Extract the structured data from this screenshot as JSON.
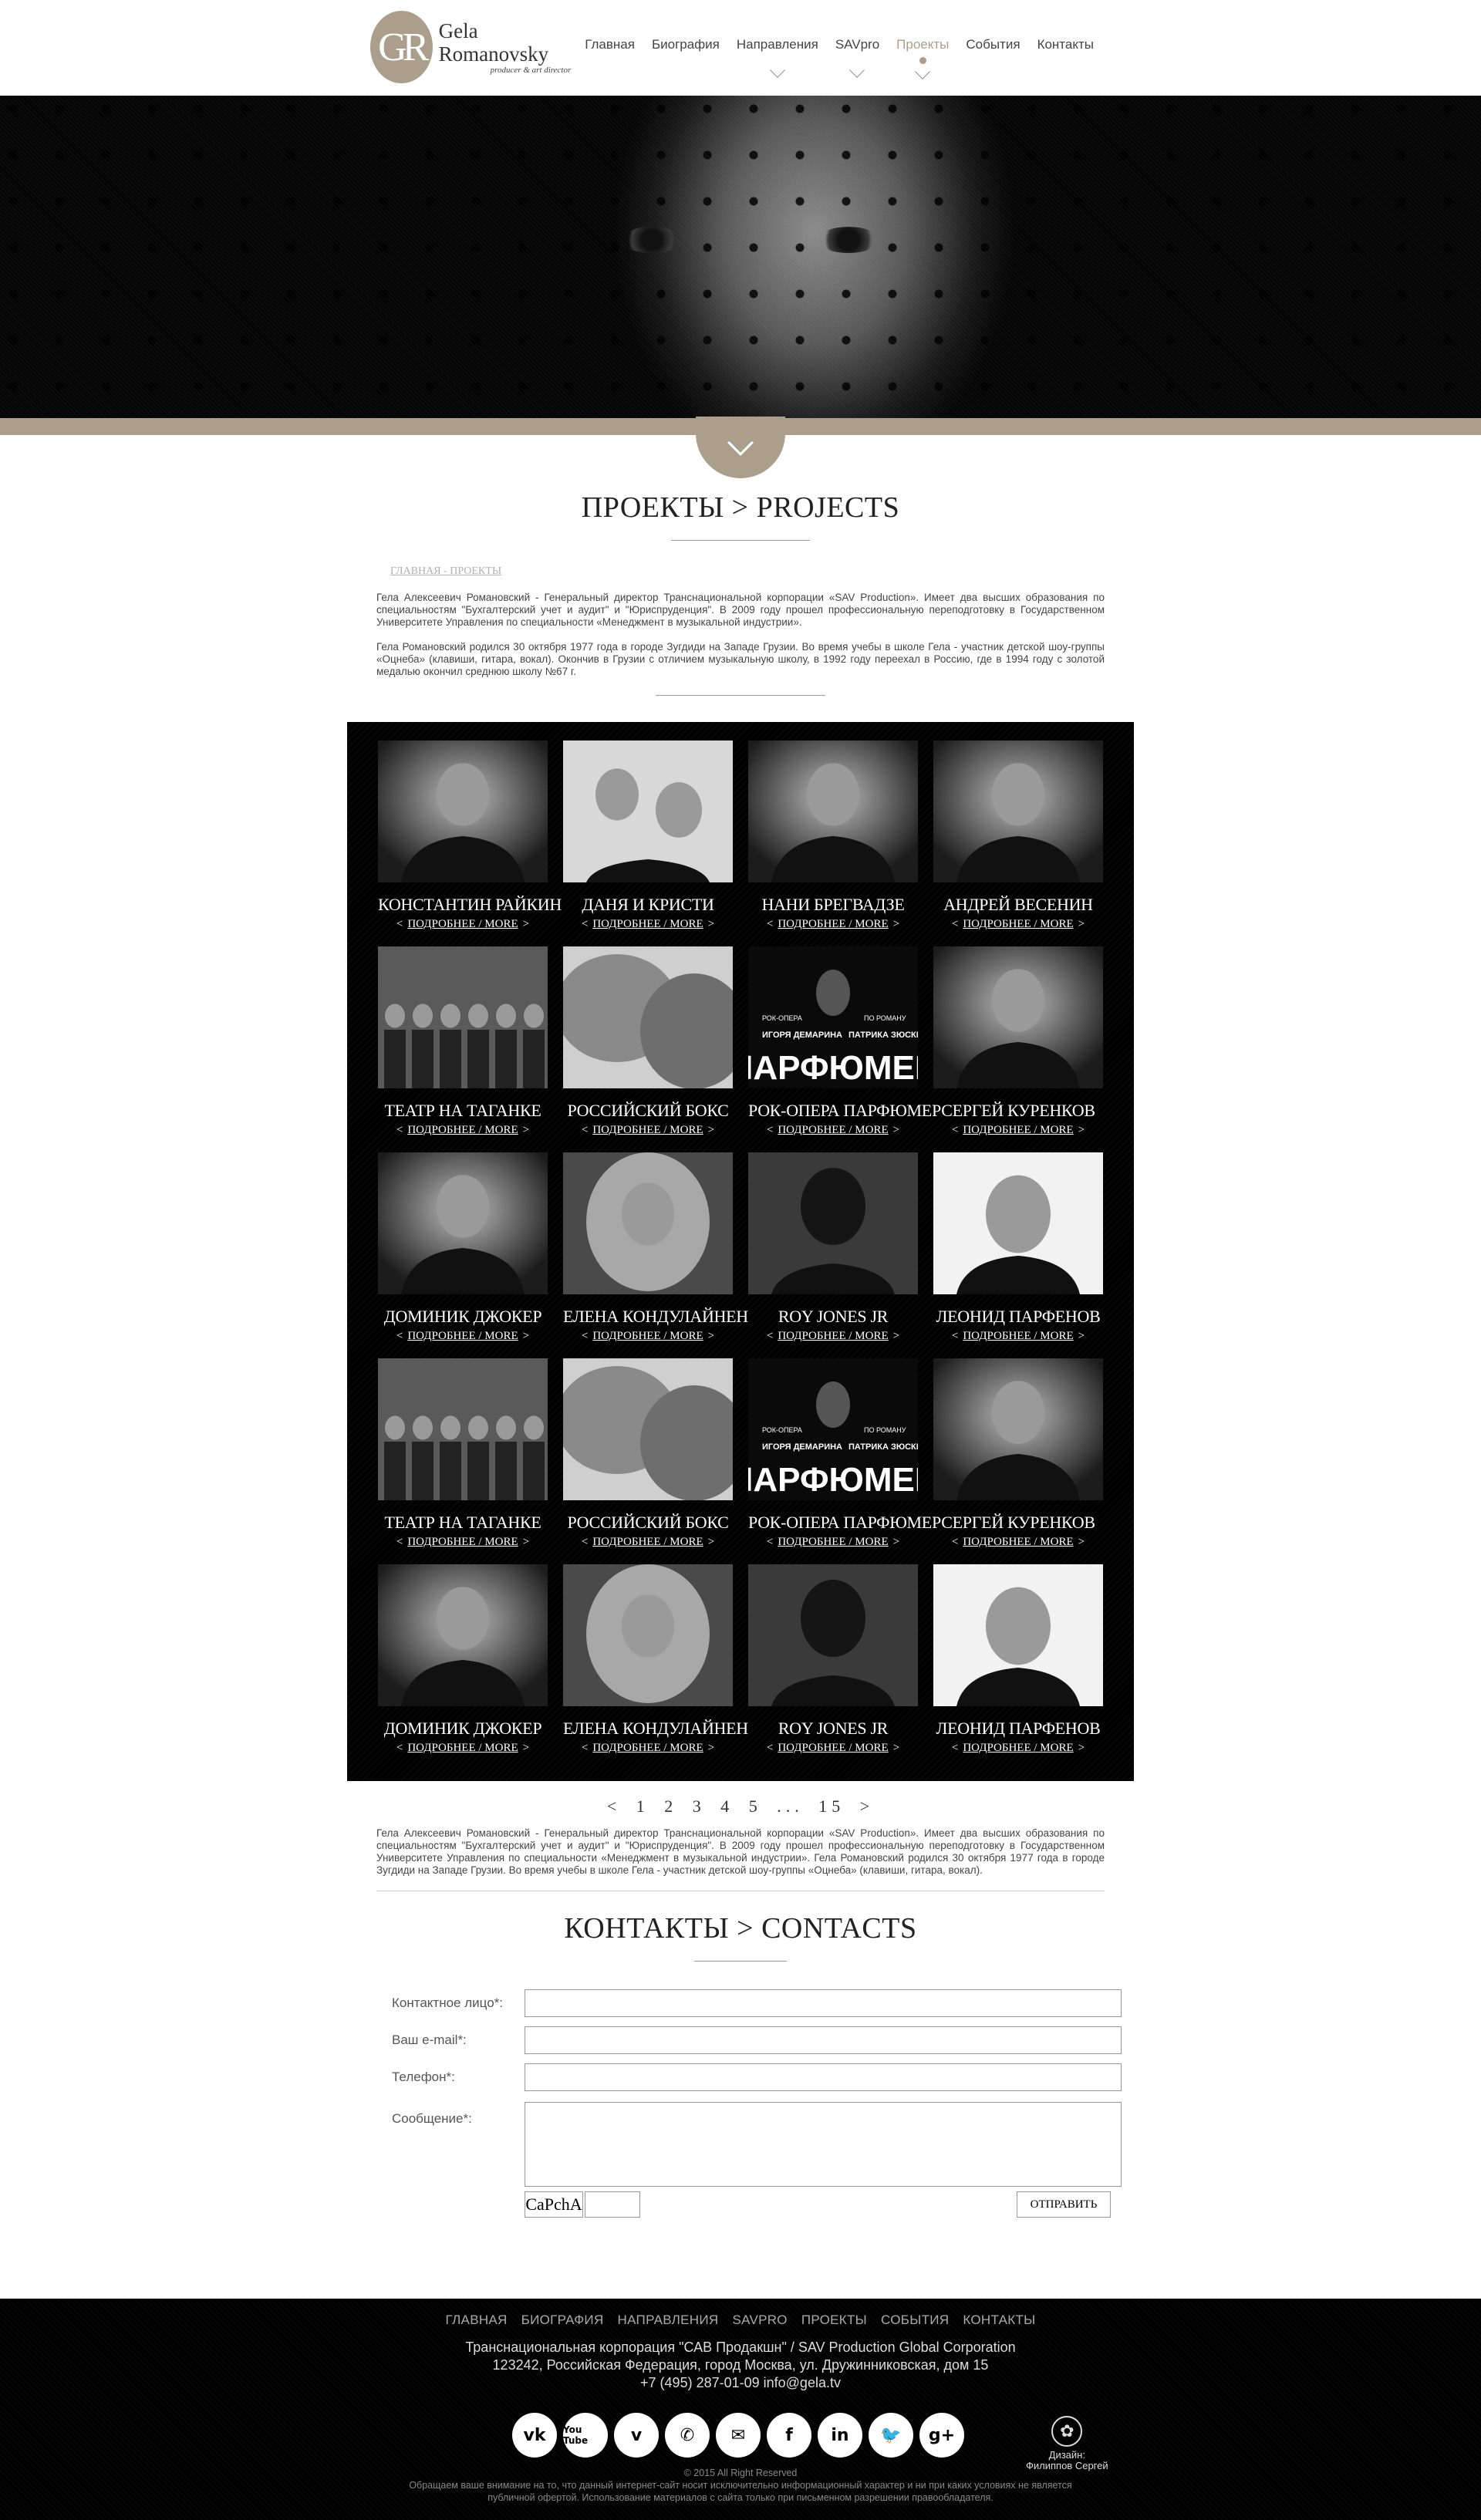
{
  "header": {
    "logo_mark": "GR",
    "logo_name": "Gela Romanovsky",
    "logo_sub": "producer & art director",
    "nav": [
      {
        "label": "Главная",
        "chev": false,
        "active": false
      },
      {
        "label": "Биография",
        "chev": false,
        "active": false
      },
      {
        "label": "Направления",
        "chev": true,
        "active": false
      },
      {
        "label": "SAVpro",
        "chev": true,
        "active": false
      },
      {
        "label": "Проекты",
        "chev": true,
        "active": true
      },
      {
        "label": "События",
        "chev": false,
        "active": false
      },
      {
        "label": "Контакты",
        "chev": false,
        "active": false
      }
    ]
  },
  "projects": {
    "title": "ПРОЕКТЫ > PROJECTS",
    "breadcrumb": "ГЛАВНАЯ - ПРОЕКТЫ",
    "para1": "Гела Алексеевич Романовский - Генеральный директор Транснациональной корпорации «SAV Production». Имеет два высших образования по специальностям \"Бухгалтерский учет и аудит\" и \"Юриспруденция\". В 2009 году прошел профессиональную переподготовку в Государственном Университете Управления по специальности «Менеджмент в музыкальной индустрии».",
    "para2": "Гела Романовский родился 30 октября 1977 года в городе Зугдиди на Западе Грузии. Во время учебы в школе Гела - участник детской шоу-группы «Оцнеба» (клавиши, гитара, вокал). Окончив в Грузии с отличием музыкальную школу, в 1992 году переехал в Россию, где в 1994 году с золотой медалью окончил среднюю школу №67 г.",
    "more_label": "ПОДРОБНЕЕ / MORE",
    "more_left": "<",
    "more_right": ">",
    "cards": [
      {
        "name": "КОНСТАНТИН РАЙКИН",
        "icon": "portrait-man-mic"
      },
      {
        "name": "ДАНЯ И КРИСТИ",
        "icon": "portrait-couple"
      },
      {
        "name": "НАНИ БРЕГВАДЗЕ",
        "icon": "portrait-woman-mic"
      },
      {
        "name": "АНДРЕЙ ВЕСЕНИН",
        "icon": "portrait-young-man"
      },
      {
        "name": "ТЕАТР НА ТАГАНКЕ",
        "icon": "theater-group"
      },
      {
        "name": "РОССИЙСКИЙ БОКС",
        "icon": "boxing-gloves"
      },
      {
        "name": "РОК-ОПЕРА ПАРФЮМЕР",
        "icon": "poster"
      },
      {
        "name": "СЕРГЕЙ КУРЕНКОВ",
        "icon": "portrait-man-suit"
      },
      {
        "name": "ДОМИНИК ДЖОКЕР",
        "icon": "portrait-smiling-man"
      },
      {
        "name": "ЕЛЕНА КОНДУЛАЙНЕН",
        "icon": "portrait-blonde"
      },
      {
        "name": "ROY JONES JR",
        "icon": "portrait-boxer"
      },
      {
        "name": "ЛЕОНИД ПАРФЕНОВ",
        "icon": "portrait-man-glasses"
      },
      {
        "name": "ТЕАТР НА ТАГАНКЕ",
        "icon": "theater-group"
      },
      {
        "name": "РОССИЙСКИЙ БОКС",
        "icon": "boxing-gloves"
      },
      {
        "name": "РОК-ОПЕРА ПАРФЮМЕР",
        "icon": "poster"
      },
      {
        "name": "СЕРГЕЙ КУРЕНКОВ",
        "icon": "portrait-man-suit"
      },
      {
        "name": "ДОМИНИК ДЖОКЕР",
        "icon": "portrait-smiling-man"
      },
      {
        "name": "ЕЛЕНА КОНДУЛАЙНЕН",
        "icon": "portrait-blonde"
      },
      {
        "name": "ROY JONES JR",
        "icon": "portrait-boxer"
      },
      {
        "name": "ЛЕОНИД ПАРФЕНОВ",
        "icon": "portrait-man-glasses"
      }
    ],
    "poster": {
      "top_left": "РОК-ОПЕРА",
      "top_right": "ПО РОМАНУ",
      "left_name": "ИГОРЯ ДЕМАРИНА",
      "right_name": "ПАТРИКА ЗЮСКИНДА",
      "big": "ПАРФЮМЕР"
    },
    "pager": {
      "prev": "<",
      "pages": [
        "1",
        "2",
        "3",
        "4",
        "5"
      ],
      "ellipsis": "...",
      "last": "15",
      "next": ">"
    },
    "para3": "Гела Алексеевич Романовский - Генеральный директор Транснациональной корпорации «SAV Production». Имеет два высших образования по специальностям \"Бухгалтерский учет и аудит\" и \"Юриспруденция\". В 2009 году прошел профессиональную переподготовку в Государственном Университете Управления по специальности «Менеджмент в музыкальной индустрии». Гела Романовский родился 30 октября 1977 года в городе Зугдиди на Западе Грузии. Во время учебы в школе Гела - участник детской шоу-группы «Оцнеба» (клавиши, гитара, вокал)."
  },
  "contacts": {
    "title": "КОНТАКТЫ > CONTACTS",
    "label_name": "Контактное лицо*:",
    "label_email": "Ваш e-mail*:",
    "label_phone": "Телефон*:",
    "label_message": "Сообщение*:",
    "captcha": "CaPchA",
    "submit": "ОТПРАВИТЬ"
  },
  "footer": {
    "nav": [
      "ГЛАВНАЯ",
      "БИОГРАФИЯ",
      "НАПРАВЛЕНИЯ",
      "SAVPRO",
      "ПРОЕКТЫ",
      "СОБЫТИЯ",
      "КОНТАКТЫ"
    ],
    "company": "Транснациональная корпорация \"САВ Продакшн\" / SAV Production Global Corporation",
    "address": "123242, Российская Федерация, город Москва, ул. Дружинниковская, дом 15",
    "contact": "+7 (495) 287-01-09 info@gela.tv",
    "socials": [
      {
        "icon": "vk-icon",
        "glyph": "vk"
      },
      {
        "icon": "youtube-icon",
        "glyph": "You Tube"
      },
      {
        "icon": "vimeo-icon",
        "glyph": "v"
      },
      {
        "icon": "phone-icon",
        "glyph": "✆"
      },
      {
        "icon": "mail-icon",
        "glyph": "✉"
      },
      {
        "icon": "facebook-icon",
        "glyph": "f"
      },
      {
        "icon": "linkedin-icon",
        "glyph": "in"
      },
      {
        "icon": "twitter-icon",
        "glyph": "🐦"
      },
      {
        "icon": "googleplus-icon",
        "glyph": "g+"
      }
    ],
    "designer_label": "Дизайн:",
    "designer_name": "Филиппов Сергей",
    "copyright": "© 2015 All Right Reserved",
    "disclaimer1": "Обращаем ваше внимание на то, что данный интернет-сайт носит исключительно информационный характер и ни при каких условиях не является",
    "disclaimer2": "публичной офертой. Использование материалов с сайта только при письменном разрешении правообладателя."
  },
  "colors": {
    "accent": "#ab9f8c",
    "dark": "#000000"
  }
}
